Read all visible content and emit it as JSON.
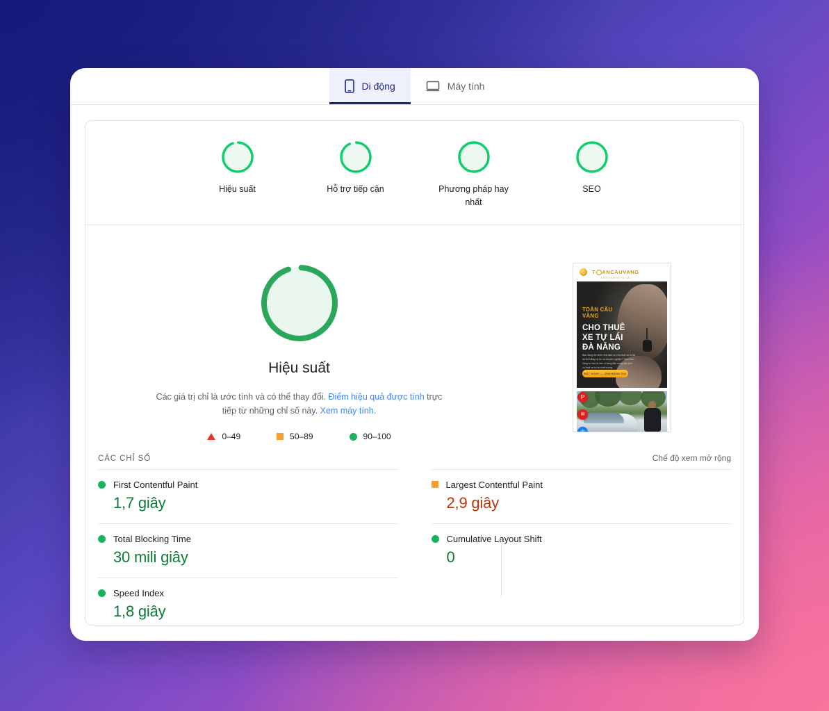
{
  "tabs": [
    {
      "label": "Di động",
      "icon": "mobile-icon",
      "active": true
    },
    {
      "label": "Máy tính",
      "icon": "desktop-icon",
      "active": false
    }
  ],
  "scores": [
    {
      "value": "94",
      "label": "Hiệu suất"
    },
    {
      "value": "93",
      "label": "Hỗ trợ tiếp cận"
    },
    {
      "value": "100",
      "label": "Phương pháp hay nhất"
    },
    {
      "value": "99",
      "label": "SEO"
    }
  ],
  "hero": {
    "score": "94",
    "title": "Hiệu suất",
    "desc_part1": "Các giá trị chỉ là ước tính và có thể thay đổi. ",
    "desc_link1": "Điểm hiệu quả được tính",
    "desc_part2": " trực tiếp từ những chỉ số này. ",
    "desc_link2": "Xem máy tính",
    "desc_part3": "."
  },
  "legend": [
    {
      "shape": "triangle",
      "label": "0–49",
      "color": "#e63329"
    },
    {
      "shape": "square",
      "label": "50–89",
      "color": "#fa9f2b"
    },
    {
      "shape": "circle",
      "label": "90–100",
      "color": "#18b35a"
    }
  ],
  "thumbnail": {
    "brand_line1": "TOÀN CẦU",
    "brand_line2": "VÀNG",
    "heading_line1": "CHO THUÊ",
    "heading_line2": "XE TỰ LÁI",
    "heading_line3": "ĐÀ NẴNG",
    "paragraph": "Bạn đang tìm kiếm một dịch vụ cho thuê xe tự lái tại Đà Nẵng uy tín và chuyên nghiệp? Toàn Cầu Vàng tự hào là đơn vị hàng đầu cung cấp dịch vụ thuê xe tự lái chất lượng.",
    "cta_label": "ĐẶT NGAY — XEM BẢNG GIÁ",
    "logo_text_left": "T",
    "logo_text_right": "ANCAUVANG",
    "logo_subtitle": "CHO THUÊ XE TỰ LÁI",
    "social_icons": [
      {
        "name": "pinterest-icon",
        "glyph": "P",
        "color": "#e02020"
      },
      {
        "name": "message-icon",
        "glyph": "✉",
        "color": "#e02020"
      },
      {
        "name": "zalo-icon",
        "glyph": "✆",
        "color": "#1877f2"
      },
      {
        "name": "phone-icon",
        "glyph": "✆",
        "color": "#e02020"
      }
    ]
  },
  "metrics_header": {
    "title": "CÁC CHỈ SỐ",
    "toggle": "Chế độ xem mở rộng"
  },
  "metrics_left": [
    {
      "name": "First Contentful Paint",
      "value": "1,7 giây",
      "status": "good"
    },
    {
      "name": "Total Blocking Time",
      "value": "30 mili giây",
      "status": "good"
    },
    {
      "name": "Speed Index",
      "value": "1,8 giây",
      "status": "good"
    }
  ],
  "metrics_right": [
    {
      "name": "Largest Contentful Paint",
      "value": "2,9 giây",
      "status": "average"
    },
    {
      "name": "Cumulative Layout Shift",
      "value": "0",
      "status": "good"
    }
  ],
  "colors": {
    "good": "#18b35a",
    "average": "#fa9f2b",
    "poor": "#e63329",
    "accent": "#1a237e",
    "link": "#4285f4"
  }
}
